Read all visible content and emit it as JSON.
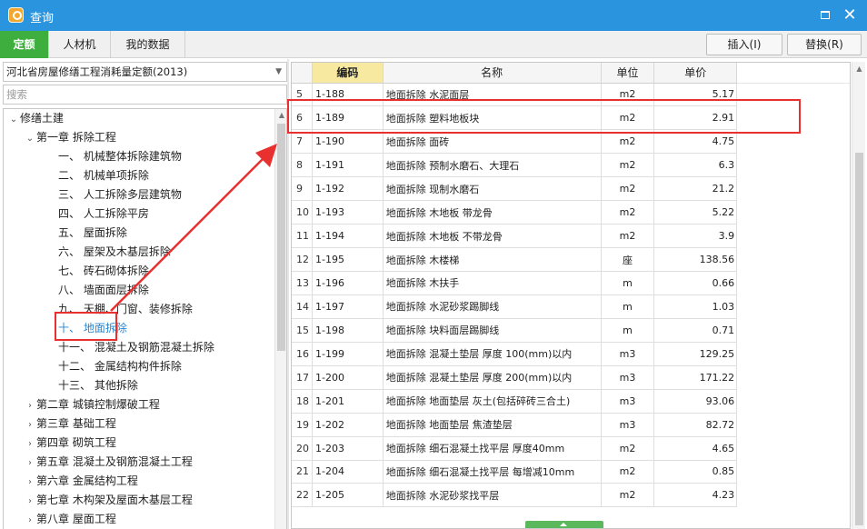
{
  "window": {
    "title": "查询",
    "icon": "app-logo-icon",
    "maximize_icon": "maximize-icon",
    "close_icon": "close-icon"
  },
  "tabs": [
    {
      "label": "定额",
      "active": true
    },
    {
      "label": "人材机",
      "active": false
    },
    {
      "label": "我的数据",
      "active": false
    }
  ],
  "actions": {
    "insert_label": "插入(I)",
    "replace_label": "替换(R)"
  },
  "sidebar": {
    "quota_selector": "河北省房屋修缮工程消耗量定额(2013)",
    "search_placeholder": "搜索",
    "tree": [
      {
        "label": "修缮土建",
        "level": 0,
        "expanded": true
      },
      {
        "label": "第一章 拆除工程",
        "level": 1,
        "expanded": true
      },
      {
        "label": "一、 机械整体拆除建筑物",
        "level": 2
      },
      {
        "label": "二、 机械单项拆除",
        "level": 2
      },
      {
        "label": "三、 人工拆除多层建筑物",
        "level": 2
      },
      {
        "label": "四、 人工拆除平房",
        "level": 2
      },
      {
        "label": "五、 屋面拆除",
        "level": 2
      },
      {
        "label": "六、 屋架及木基层拆除",
        "level": 2
      },
      {
        "label": "七、 砖石砌体拆除",
        "level": 2
      },
      {
        "label": "八、 墙面面层拆除",
        "level": 2
      },
      {
        "label": "九、 天棚、门窗、装修拆除",
        "level": 2
      },
      {
        "label": "十、 地面拆除",
        "level": 2,
        "selected": true
      },
      {
        "label": "十一、 混凝土及钢筋混凝土拆除",
        "level": 2
      },
      {
        "label": "十二、 金属结构构件拆除",
        "level": 2
      },
      {
        "label": "十三、 其他拆除",
        "level": 2
      },
      {
        "label": "第二章 城镇控制爆破工程",
        "level": 1,
        "expanded": false
      },
      {
        "label": "第三章 基础工程",
        "level": 1,
        "expanded": false
      },
      {
        "label": "第四章 砌筑工程",
        "level": 1,
        "expanded": false
      },
      {
        "label": "第五章 混凝土及钢筋混凝土工程",
        "level": 1,
        "expanded": false
      },
      {
        "label": "第六章 金属结构工程",
        "level": 1,
        "expanded": false
      },
      {
        "label": "第七章 木构架及屋面木基层工程",
        "level": 1,
        "expanded": false
      },
      {
        "label": "第八章 屋面工程",
        "level": 1,
        "expanded": false
      }
    ]
  },
  "grid": {
    "columns": {
      "code": "编码",
      "name": "名称",
      "unit": "单位",
      "price": "单价"
    },
    "rows": [
      {
        "idx": "5",
        "code": "1-188",
        "name": "地面拆除 水泥面层",
        "unit": "m2",
        "price": "5.17"
      },
      {
        "idx": "6",
        "code": "1-189",
        "name": "地面拆除 塑料地板块",
        "unit": "m2",
        "price": "2.91",
        "highlighted": true
      },
      {
        "idx": "7",
        "code": "1-190",
        "name": "地面拆除 面砖",
        "unit": "m2",
        "price": "4.75"
      },
      {
        "idx": "8",
        "code": "1-191",
        "name": "地面拆除 预制水磨石、大理石",
        "unit": "m2",
        "price": "6.3"
      },
      {
        "idx": "9",
        "code": "1-192",
        "name": "地面拆除 现制水磨石",
        "unit": "m2",
        "price": "21.2"
      },
      {
        "idx": "10",
        "code": "1-193",
        "name": "地面拆除 木地板 带龙骨",
        "unit": "m2",
        "price": "5.22"
      },
      {
        "idx": "11",
        "code": "1-194",
        "name": "地面拆除 木地板 不带龙骨",
        "unit": "m2",
        "price": "3.9"
      },
      {
        "idx": "12",
        "code": "1-195",
        "name": "地面拆除 木楼梯",
        "unit": "座",
        "price": "138.56"
      },
      {
        "idx": "13",
        "code": "1-196",
        "name": "地面拆除 木扶手",
        "unit": "m",
        "price": "0.66"
      },
      {
        "idx": "14",
        "code": "1-197",
        "name": "地面拆除 水泥砂浆踢脚线",
        "unit": "m",
        "price": "1.03"
      },
      {
        "idx": "15",
        "code": "1-198",
        "name": "地面拆除 块料面层踢脚线",
        "unit": "m",
        "price": "0.71"
      },
      {
        "idx": "16",
        "code": "1-199",
        "name": "地面拆除 混凝土垫层 厚度 100(mm)以内",
        "unit": "m3",
        "price": "129.25"
      },
      {
        "idx": "17",
        "code": "1-200",
        "name": "地面拆除 混凝土垫层 厚度 200(mm)以内",
        "unit": "m3",
        "price": "171.22"
      },
      {
        "idx": "18",
        "code": "1-201",
        "name": "地面拆除 地面垫层 灰土(包括碎砖三合土)",
        "unit": "m3",
        "price": "93.06"
      },
      {
        "idx": "19",
        "code": "1-202",
        "name": "地面拆除 地面垫层 焦渣垫层",
        "unit": "m3",
        "price": "82.72"
      },
      {
        "idx": "20",
        "code": "1-203",
        "name": "地面拆除 细石混凝土找平层 厚度40mm",
        "unit": "m2",
        "price": "4.65"
      },
      {
        "idx": "21",
        "code": "1-204",
        "name": "地面拆除 细石混凝土找平层 每增减10mm",
        "unit": "m2",
        "price": "0.85"
      },
      {
        "idx": "22",
        "code": "1-205",
        "name": "地面拆除 水泥砂浆找平层",
        "unit": "m2",
        "price": "4.23"
      }
    ]
  },
  "annotation_color": "#e8312f",
  "accent_color": "#3eae3e",
  "titlebar_color": "#2a95de"
}
